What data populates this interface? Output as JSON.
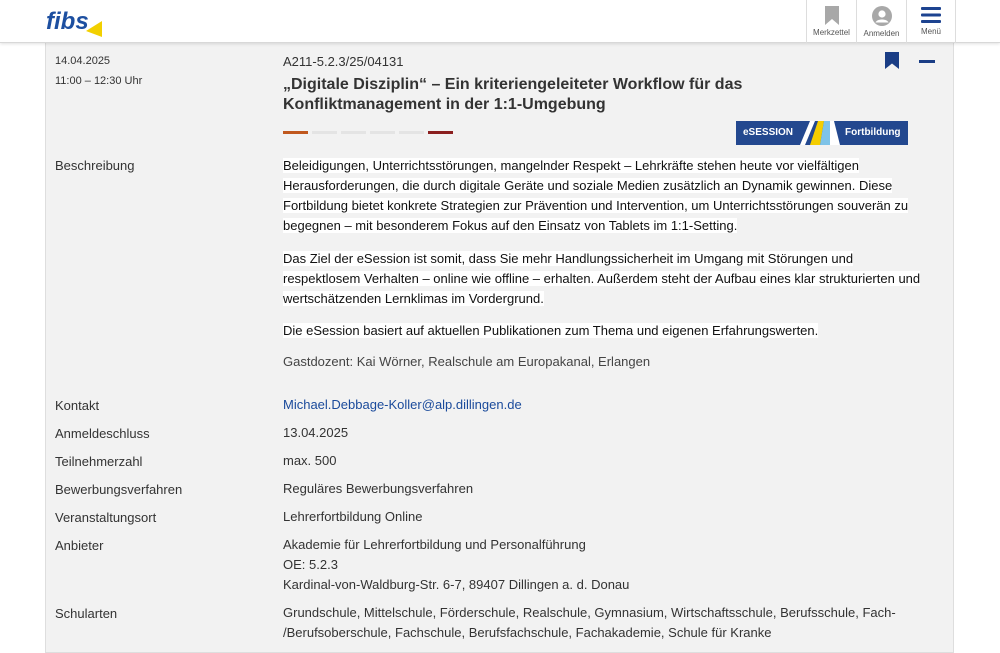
{
  "header": {
    "logo_text": "fibs",
    "buttons": [
      {
        "label": "Merkzettel",
        "icon": "bookmark-icon"
      },
      {
        "label": "Anmelden",
        "icon": "user-icon"
      },
      {
        "label": "Menü",
        "icon": "hamburger-icon"
      }
    ]
  },
  "event": {
    "date": "14.04.2025",
    "time": "11:00 – 12:30 Uhr",
    "code": "A211-5.2.3/25/04131",
    "title": "„Digitale Disziplin“ – Ein kriteriengeleiteter Workflow für das Konfliktmanagement in der 1:1-Umgebung",
    "bar_colors": [
      "#c0581e",
      "#e4e4e4",
      "#e4e4e4",
      "#e4e4e4",
      "#e4e4e4",
      "#8b1f1f"
    ],
    "badge": {
      "left": "eSESSION",
      "right": "Fortbildung"
    }
  },
  "description": {
    "label": "Beschreibung",
    "paragraphs": [
      "Beleidigungen, Unterrichtsstörungen, mangelnder Respekt – Lehrkräfte stehen heute vor vielfältigen Herausforderungen, die durch digitale Geräte und soziale Medien zusätzlich an Dynamik gewinnen. Diese Fortbildung bietet konkrete Strategien zur Prävention und Intervention, um Unterrichtsstörungen souverän zu begegnen – mit besonderem Fokus auf den Einsatz von Tablets im 1:1-Setting.",
      "Das Ziel der eSession ist somit, dass Sie mehr Handlungssicherheit im Umgang mit Störungen und respektlosem Verhalten – online wie offline – erhalten. Außerdem steht der Aufbau eines klar strukturierten und wertschätzenden Lernklimas im Vordergrund.",
      "Die eSession basiert auf aktuellen Publikationen zum Thema und eigenen Erfahrungswerten."
    ],
    "guest": "Gastdozent: Kai Wörner, Realschule am Europakanal, Erlangen"
  },
  "details": {
    "kontakt": {
      "label": "Kontakt",
      "value": "Michael.Debbage-Koller@alp.dillingen.de"
    },
    "anmeldeschluss": {
      "label": "Anmeldeschluss",
      "value": "13.04.2025"
    },
    "teilnehmerzahl": {
      "label": "Teilnehmerzahl",
      "value": "max. 500"
    },
    "bewerbung": {
      "label": "Bewerbungsverfahren",
      "value": "Reguläres Bewerbungsverfahren"
    },
    "ort": {
      "label": "Veranstaltungsort",
      "value": "Lehrerfortbildung Online"
    },
    "anbieter": {
      "label": "Anbieter",
      "line1": "Akademie für Lehrerfortbildung und Personalführung",
      "line2": "OE: 5.2.3",
      "line3": "Kardinal-von-Waldburg-Str. 6-7, 89407 Dillingen a. d. Donau"
    },
    "schularten": {
      "label": "Schularten",
      "line1": "Grundschule, Mittelschule, Förderschule, Realschule, Gymnasium, Wirtschaftsschule, Berufsschule, Fach-",
      "line2": "/Berufsoberschule, Fachschule, Berufsfachschule, Fachakademie, Schule für Kranke"
    }
  }
}
